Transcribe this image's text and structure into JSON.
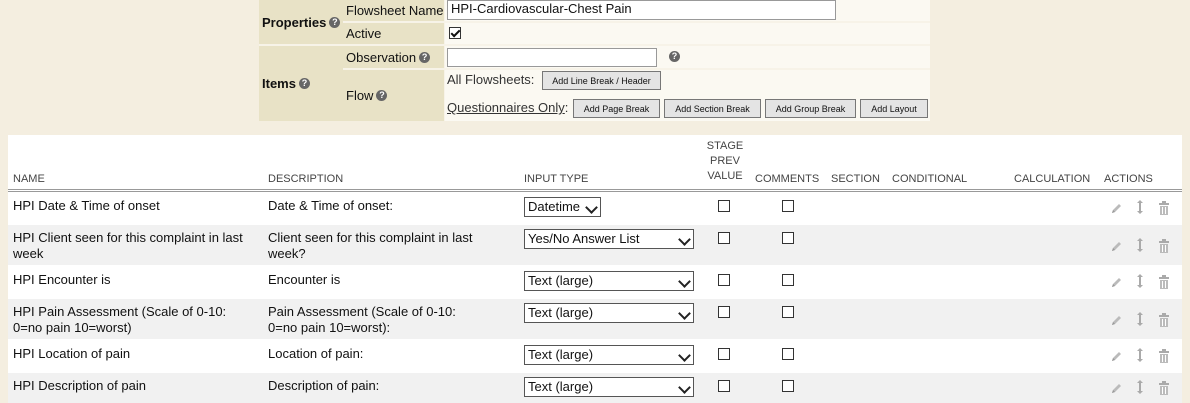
{
  "properties": {
    "label": "Properties",
    "flowsheet_name_label": "Flowsheet Name",
    "flowsheet_name_value": "HPI-Cardiovascular-Chest Pain",
    "active_label": "Active",
    "active_checked": true
  },
  "items_section": {
    "label": "Items",
    "observation_label": "Observation",
    "observation_value": "",
    "flow_label": "Flow",
    "all_flowsheets_label": "All Flowsheets:",
    "questionnaires_only_label": "Questionnaires Only",
    "questionnaires_colon": ":",
    "buttons": {
      "line_break_header": "Add Line Break / Header",
      "page_break": "Add Page Break",
      "section_break": "Add Section Break",
      "group_break": "Add Group Break",
      "layout": "Add Layout"
    }
  },
  "table": {
    "headers": {
      "name": "NAME",
      "description": "DESCRIPTION",
      "input_type": "INPUT TYPE",
      "stage_prev_value_line1": "STAGE",
      "stage_prev_value_line2": "PREV",
      "stage_prev_value_line3": "VALUE",
      "comments": "COMMENTS",
      "section": "SECTION",
      "conditional": "CONDITIONAL",
      "calculation": "CALCULATION",
      "actions": "ACTIONS"
    },
    "rows": [
      {
        "name": "HPI Date & Time of onset",
        "description": "Date & Time of onset:",
        "input_type": "Datetime",
        "stage_prev": false,
        "comments": false
      },
      {
        "name": "HPI Client seen for this complaint in last week",
        "description": "Client seen for this complaint in last week?",
        "input_type": "Yes/No Answer List",
        "stage_prev": false,
        "comments": false
      },
      {
        "name": "HPI Encounter is",
        "description": "Encounter is",
        "input_type": "Text (large)",
        "stage_prev": false,
        "comments": false
      },
      {
        "name": "HPI Pain Assessment (Scale of 0-10: 0=no pain 10=worst)",
        "description": "Pain Assessment (Scale of 0-10: 0=no pain 10=worst):",
        "input_type": "Text (large)",
        "stage_prev": false,
        "comments": false
      },
      {
        "name": "HPI Location of pain",
        "description": "Location of pain:",
        "input_type": "Text (large)",
        "stage_prev": false,
        "comments": false
      },
      {
        "name": "HPI Description of pain",
        "description": "Description of pain:",
        "input_type": "Text (large)",
        "stage_prev": false,
        "comments": false
      }
    ]
  },
  "icons": {
    "help": "help-icon",
    "edit": "pencil-icon",
    "move": "move-vertical-icon",
    "delete": "trash-icon"
  },
  "colors": {
    "page_background": "#f4eee0",
    "label_background": "#e8e2c6",
    "row_alt_background": "#f1f1f1"
  }
}
